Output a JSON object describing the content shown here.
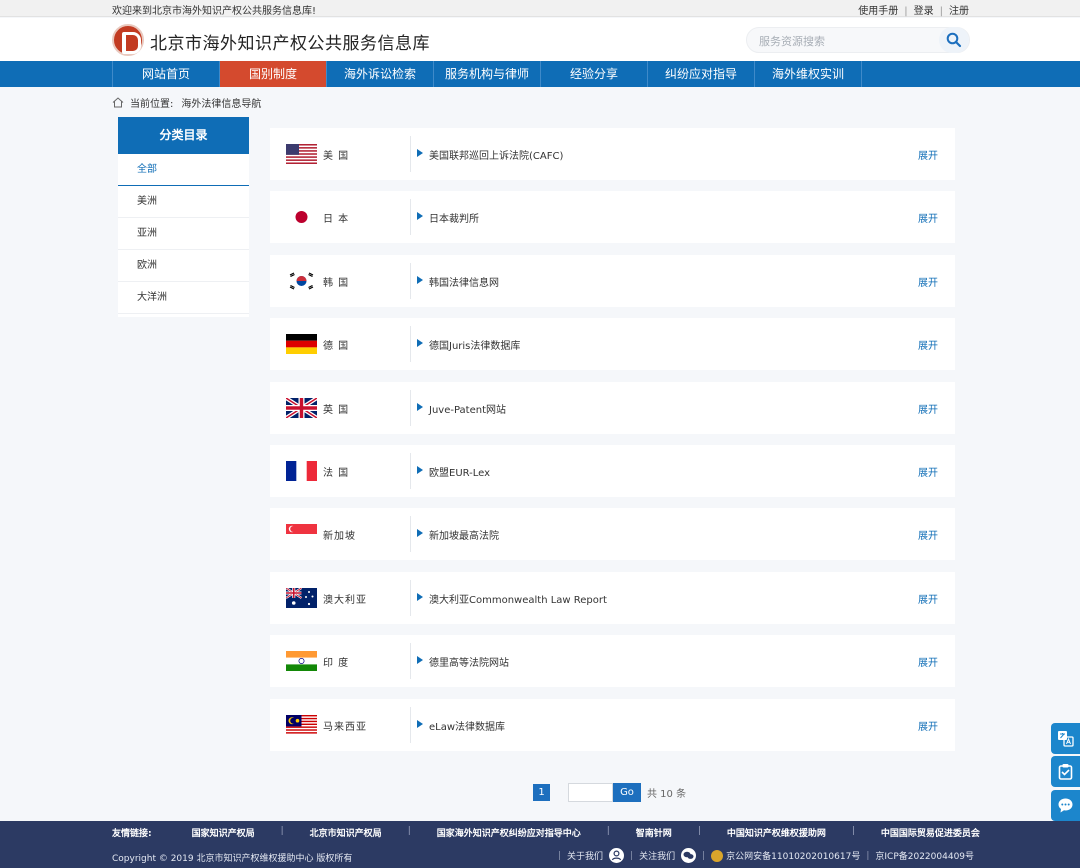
{
  "topbar": {
    "welcome": "欢迎来到北京市海外知识产权公共服务信息库!",
    "links": [
      "使用手册",
      "登录",
      "注册"
    ]
  },
  "header": {
    "title": "北京市海外知识产权公共服务信息库",
    "search_placeholder": "服务资源搜索"
  },
  "nav": {
    "items": [
      "网站首页",
      "国别制度",
      "海外诉讼检索",
      "服务机构与律师",
      "经验分享",
      "纠纷应对指导",
      "海外维权实训"
    ],
    "active_index": 1
  },
  "breadcrumb": {
    "label": "当前位置:",
    "current": "海外法律信息导航"
  },
  "sidebar": {
    "title": "分类目录",
    "categories": [
      "全部",
      "美洲",
      "亚洲",
      "欧洲",
      "大洋洲"
    ],
    "active_index": 0
  },
  "list": {
    "expand_label": "展开",
    "rows": [
      {
        "country": "美 国",
        "link": "美国联邦巡回上诉法院(CAFC)",
        "flag": "us-flag"
      },
      {
        "country": "日 本",
        "link": "日本裁判所",
        "flag": "jp-flag"
      },
      {
        "country": "韩 国",
        "link": "韩国法律信息网",
        "flag": "kr-flag"
      },
      {
        "country": "德 国",
        "link": "德国Juris法律数据库",
        "flag": "de-flag"
      },
      {
        "country": "英 国",
        "link": "Juve-Patent网站",
        "flag": "gb-flag"
      },
      {
        "country": "法 国",
        "link": "欧盟EUR-Lex",
        "flag": "fr-flag"
      },
      {
        "country": "新加坡",
        "link": "新加坡最高法院",
        "flag": "sg-flag"
      },
      {
        "country": "澳大利亚",
        "link": "澳大利亚Commonwealth Law Report",
        "flag": "au-flag"
      },
      {
        "country": "印 度",
        "link": "德里高等法院网站",
        "flag": "in-flag"
      },
      {
        "country": "马来西亚",
        "link": "eLaw法律数据库",
        "flag": "my-flag"
      }
    ]
  },
  "pagination": {
    "current_page": "1",
    "jump_value": "",
    "go_label": "Go",
    "total": "共 10 条"
  },
  "footer": {
    "friend_label": "友情链接:",
    "friend_links": [
      "国家知识产权局",
      "北京市知识产权局",
      "国家海外知识产权纠纷应对指导中心",
      "智南针网",
      "中国知识产权维权援助网",
      "中国国际贸易促进委员会"
    ],
    "copyright": "Copyright © 2019 北京市知识产权维权援助中心 版权所有",
    "about": "关于我们",
    "follow": "关注我们",
    "police": "京公网安备11010202010617号",
    "icp": "京ICP备2022004409号"
  },
  "colors": {
    "nav_blue": "#0f6db6",
    "nav_active": "#d44a2e",
    "footer_bg": "#2c3a63",
    "float_blue": "#1c86cc"
  }
}
